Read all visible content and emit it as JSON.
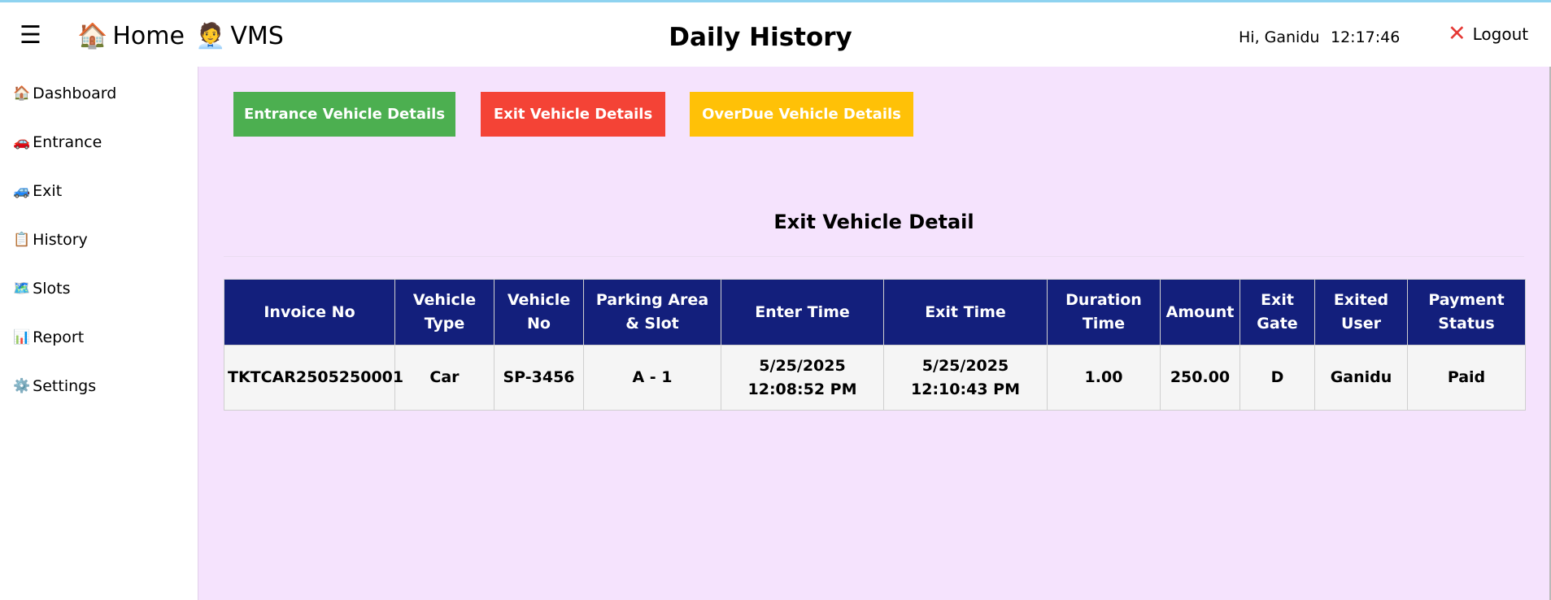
{
  "header": {
    "menu_icon": "☰",
    "home": {
      "icon": "🏠",
      "icon_name": "house-icon",
      "label": "Home"
    },
    "vms": {
      "icon": "🧑‍💼",
      "icon_name": "office-worker-icon",
      "label": "VMS"
    },
    "title": "Daily History",
    "greeting": "Hi, Ganidu",
    "time": "12:17:46",
    "logout": {
      "icon": "✕",
      "icon_name": "close-icon",
      "label": "Logout",
      "icon_color": "#e53935"
    }
  },
  "sidebar": {
    "items": [
      {
        "icon": "🏠",
        "icon_name": "house-icon",
        "label": "Dashboard"
      },
      {
        "icon": "🚗",
        "icon_name": "car-icon",
        "label": "Entrance"
      },
      {
        "icon": "🚙",
        "icon_name": "suv-icon",
        "label": "Exit"
      },
      {
        "icon": "📋",
        "icon_name": "clipboard-icon",
        "label": "History"
      },
      {
        "icon": "🗺️",
        "icon_name": "map-icon",
        "label": "Slots"
      },
      {
        "icon": "📊",
        "icon_name": "bar-chart-icon",
        "label": "Report"
      },
      {
        "icon": "⚙️",
        "icon_name": "gear-icon",
        "label": "Settings"
      }
    ]
  },
  "buttons": {
    "entrance": {
      "label": "Entrance Vehicle Details",
      "color": "#4caf50"
    },
    "exit": {
      "label": "Exit Vehicle Details",
      "color": "#f44336"
    },
    "overdue": {
      "label": "OverDue Vehicle Details",
      "color": "#ffc107"
    }
  },
  "section_title": "Exit Vehicle Detail",
  "table": {
    "header_color": "#131f7c",
    "columns": [
      "Invoice No",
      "Vehicle Type",
      "Vehicle No",
      "Parking Area & Slot",
      "Enter Time",
      "Exit Time",
      "Duration Time",
      "Amount",
      "Exit Gate",
      "Exited User",
      "Payment Status"
    ],
    "rows": [
      [
        "TKTCAR2505250001",
        "Car",
        "SP-3456",
        "A - 1",
        "5/25/2025 12:08:52 PM",
        "5/25/2025 12:10:43 PM",
        "1.00",
        "250.00",
        "D",
        "Ganidu",
        "Paid"
      ]
    ]
  }
}
